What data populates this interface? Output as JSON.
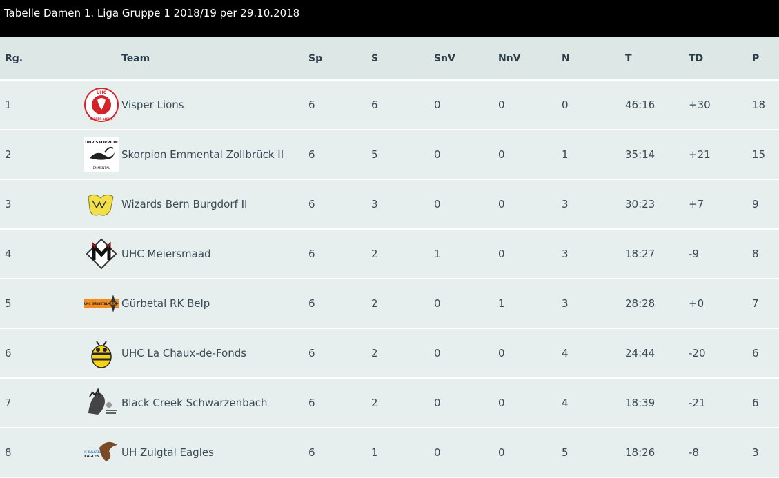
{
  "title": "Tabelle Damen 1. Liga Gruppe 1 2018/19 per 29.10.2018",
  "headers": {
    "rg": "Rg.",
    "team": "Team",
    "sp": "Sp",
    "s": "S",
    "snv": "SnV",
    "nnv": "NnV",
    "n": "N",
    "t": "T",
    "td": "TD",
    "p": "P"
  },
  "rows": [
    {
      "rg": "1",
      "team": "Visper Lions",
      "logo": "visper-lions-logo-icon",
      "sp": "6",
      "s": "6",
      "snv": "0",
      "nnv": "0",
      "n": "0",
      "t": "46:16",
      "td": "+30",
      "p": "18"
    },
    {
      "rg": "2",
      "team": "Skorpion Emmental Zollbrück II",
      "logo": "skorpion-logo-icon",
      "sp": "6",
      "s": "5",
      "snv": "0",
      "nnv": "0",
      "n": "1",
      "t": "35:14",
      "td": "+21",
      "p": "15"
    },
    {
      "rg": "3",
      "team": "Wizards Bern Burgdorf II",
      "logo": "wizards-logo-icon",
      "sp": "6",
      "s": "3",
      "snv": "0",
      "nnv": "0",
      "n": "3",
      "t": "30:23",
      "td": "+7",
      "p": "9"
    },
    {
      "rg": "4",
      "team": "UHC Meiersmaad",
      "logo": "meiersmaad-logo-icon",
      "sp": "6",
      "s": "2",
      "snv": "1",
      "nnv": "0",
      "n": "3",
      "t": "18:27",
      "td": "-9",
      "p": "8"
    },
    {
      "rg": "5",
      "team": "Gürbetal RK Belp",
      "logo": "guerbetal-logo-icon",
      "sp": "6",
      "s": "2",
      "snv": "0",
      "nnv": "1",
      "n": "3",
      "t": "28:28",
      "td": "+0",
      "p": "7"
    },
    {
      "rg": "6",
      "team": "UHC La Chaux-de-Fonds",
      "logo": "chaux-de-fonds-bee-logo-icon",
      "sp": "6",
      "s": "2",
      "snv": "0",
      "nnv": "0",
      "n": "4",
      "t": "24:44",
      "td": "-20",
      "p": "6"
    },
    {
      "rg": "7",
      "team": "Black Creek Schwarzenbach",
      "logo": "black-creek-logo-icon",
      "sp": "6",
      "s": "2",
      "snv": "0",
      "nnv": "0",
      "n": "4",
      "t": "18:39",
      "td": "-21",
      "p": "6"
    },
    {
      "rg": "8",
      "team": "UH Zulgtal Eagles",
      "logo": "zulgtal-eagles-logo-icon",
      "sp": "6",
      "s": "1",
      "snv": "0",
      "nnv": "0",
      "n": "5",
      "t": "18:26",
      "td": "-8",
      "p": "3"
    }
  ],
  "logo_text": {
    "uhc_visper_top": "UHC",
    "uhc_visper_bottom": "VISPER-LIONS",
    "skorpion_top": "UHV SKORPION",
    "skorpion_bottom": "EMMENTAL",
    "guerbetal": "UHC GÜRBETAL",
    "guerbetal_rk": "RK",
    "zulgtal": "UH ZULGTAL",
    "zulgtal_eagles": "EAGLES"
  }
}
